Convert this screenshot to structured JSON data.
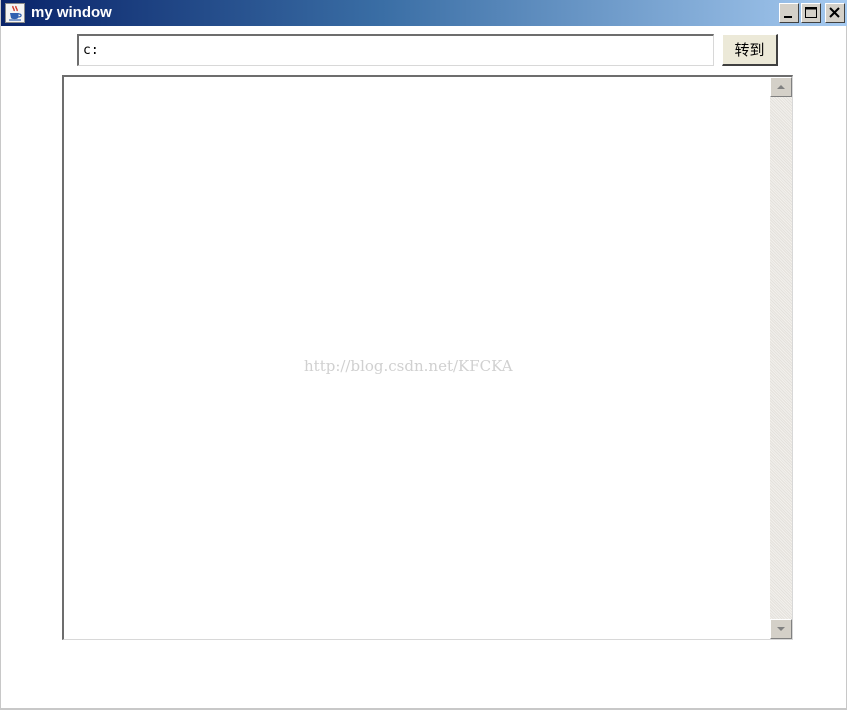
{
  "window": {
    "title": "my window",
    "icon": "java-cup-icon"
  },
  "window_controls": [
    "minimize-icon",
    "maximize-icon",
    "close-icon"
  ],
  "address_bar": {
    "value": "c:",
    "go_label": "转到"
  },
  "content": {
    "text": "",
    "watermark": "http://blog.csdn.net/KFCKA"
  },
  "scrollbar": {
    "up_icon": "arrow-up-icon",
    "down_icon": "arrow-down-icon"
  },
  "colors": {
    "title_start": "#0a246a",
    "title_end": "#a6caf0",
    "button_face": "#d4d0c8"
  }
}
